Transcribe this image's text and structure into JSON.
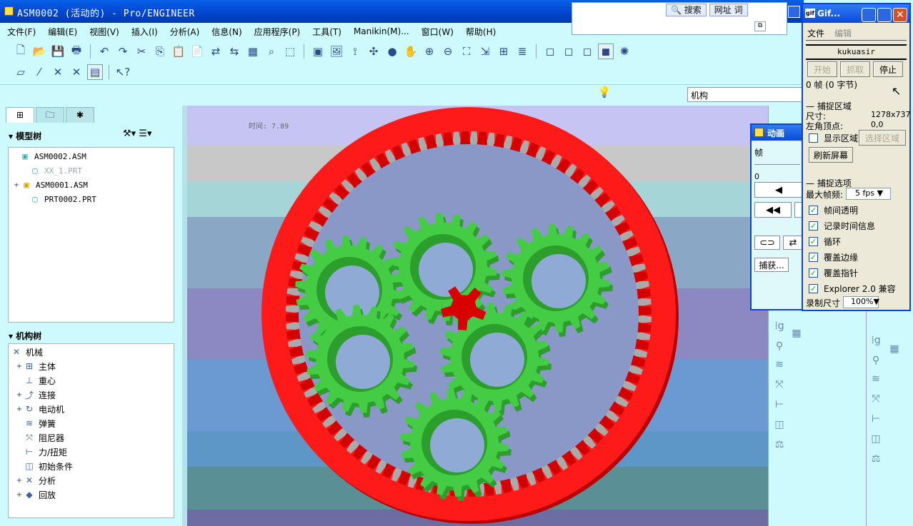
{
  "window": {
    "title": "ASM0002 (活动的) - Pro/ENGINEER"
  },
  "ie": {
    "search_label": "搜索",
    "address_label": "网址",
    "word_label": "词"
  },
  "menu": [
    "文件(F)",
    "编辑(E)",
    "视图(V)",
    "插入(I)",
    "分析(A)",
    "信息(N)",
    "应用程序(P)",
    "工具(T)",
    "Manikin(M)...",
    "窗口(W)",
    "帮助(H)"
  ],
  "status": {
    "mechanism_field": "机构"
  },
  "model_tree": {
    "title": "模型树",
    "items": [
      {
        "label": "ASM0002.ASM",
        "dim": false
      },
      {
        "label": "XX_1.PRT",
        "dim": true
      },
      {
        "label": "ASM0001.ASM",
        "dim": false
      },
      {
        "label": "PRT0002.PRT",
        "dim": false
      }
    ]
  },
  "mech_tree": {
    "title": "机构树",
    "root": "机械",
    "items": [
      "主体",
      "重心",
      "连接",
      "电动机",
      "弹簧",
      "阻尼器",
      "力/扭矩",
      "初始条件",
      "分析",
      "回放"
    ]
  },
  "viewport": {
    "time_label": "时间: 7.89"
  },
  "anim": {
    "title": "动画",
    "frame_label": "帧",
    "frame_value": "0",
    "capture_label": "捕获..."
  },
  "gif": {
    "title": "Gif...",
    "menu": [
      "文件",
      "编辑"
    ],
    "name": "kukuasir",
    "buttons": {
      "start": "开始",
      "grab": "抓取",
      "stop": "停止"
    },
    "frames": "0 帧 (0 字节)",
    "capture_area": {
      "heading": "捕捉区域",
      "size_label": "尺寸:",
      "size_value": "1278x737",
      "corner_label": "左角顶点:",
      "corner_value": "0,0",
      "show_area": "显示区域",
      "select_area": "选择区域",
      "refresh": "刷新屏幕"
    },
    "options": {
      "heading": "捕捉选项",
      "max_fps_label": "最大帧频:",
      "max_fps_value": "5 fps",
      "checks": [
        "帧间透明",
        "记录时间信息",
        "循环",
        "覆盖边缘",
        "覆盖指针",
        "Explorer 2.0 兼容"
      ],
      "rec_size_label": "录制尺寸",
      "rec_size_value": "100%"
    }
  }
}
